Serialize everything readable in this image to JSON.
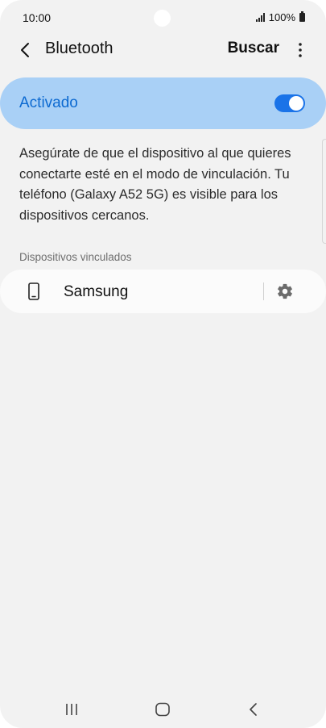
{
  "status_bar": {
    "time": "10:00",
    "battery": "100%",
    "signal_icon": "signal-icon",
    "battery_icon": "battery-icon"
  },
  "app_bar": {
    "back_icon": "chevron-left-icon",
    "title": "Bluetooth",
    "search_label": "Buscar",
    "more_icon": "more-vertical-icon"
  },
  "bluetooth_toggle": {
    "label": "Activado",
    "state": "on",
    "accent_color": "#1a73e8",
    "card_color": "#a9d0f6"
  },
  "description": "Asegúrate de que el dispositivo al que quieres conectarte esté en el modo de vinculación. Tu teléfono (Galaxy A52 5G) es visible para los dispositivos cercanos.",
  "paired_section": {
    "header": "Dispositivos vinculados",
    "devices": [
      {
        "name": "Samsung",
        "icon": "phone-icon",
        "settings_icon": "gear-icon"
      }
    ]
  },
  "nav_bar": {
    "recents_icon": "recents-icon",
    "home_icon": "home-icon",
    "back_icon": "back-icon"
  }
}
